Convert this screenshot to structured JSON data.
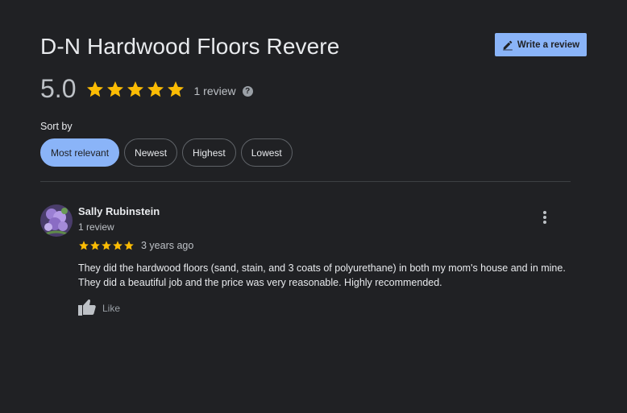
{
  "business": {
    "name": "D-N Hardwood Floors Revere",
    "rating": "5.0",
    "rating_stars": 5,
    "review_count": "1 review"
  },
  "actions": {
    "write_review_label": "Write a review"
  },
  "sort": {
    "label": "Sort by",
    "options": [
      "Most relevant",
      "Newest",
      "Highest",
      "Lowest"
    ],
    "selected": "Most relevant"
  },
  "reviews": [
    {
      "author": "Sally Rubinstein",
      "author_review_count": "1 review",
      "stars": 5,
      "date": "3 years ago",
      "text": "They did the hardwood floors (sand,  stain,  and 3 coats of polyurethane) in both my mom's house and in mine. They did a beautiful job and the price was very reasonable. Highly recommended.",
      "like_label": "Like"
    }
  ],
  "colors": {
    "background": "#202124",
    "accent": "#8ab4f8",
    "star": "#fbbc04"
  }
}
